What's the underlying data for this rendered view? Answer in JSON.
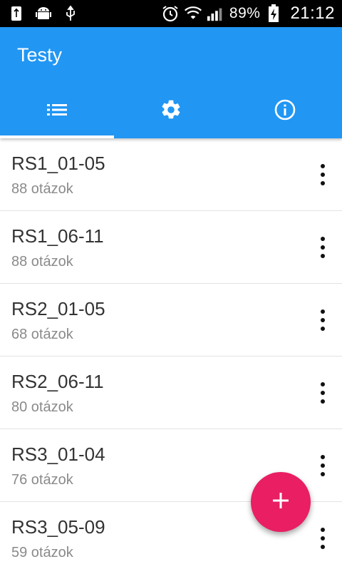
{
  "status_bar": {
    "battery_percent": "89%",
    "time": "21:12",
    "icons": [
      "usb-icon",
      "android-debug-icon",
      "usb-connection-icon",
      "alarm-icon",
      "wifi-icon",
      "signal-icon",
      "battery-charging-icon"
    ]
  },
  "app_bar": {
    "title": "Testy",
    "tabs": [
      {
        "icon": "list-icon",
        "active": true
      },
      {
        "icon": "settings-icon",
        "active": false
      },
      {
        "icon": "info-icon",
        "active": false
      }
    ]
  },
  "tests": [
    {
      "name": "RS1_01-05",
      "count": "88 otázok"
    },
    {
      "name": "RS1_06-11",
      "count": "88 otázok"
    },
    {
      "name": "RS2_01-05",
      "count": "68 otázok"
    },
    {
      "name": "RS2_06-11",
      "count": "80 otázok"
    },
    {
      "name": "RS3_01-04",
      "count": "76 otázok"
    },
    {
      "name": "RS3_05-09",
      "count": "59 otázok"
    }
  ],
  "fab": {
    "icon": "plus-icon"
  },
  "colors": {
    "primary": "#2196F3",
    "accent": "#E91E63",
    "status_bar": "#000000"
  }
}
